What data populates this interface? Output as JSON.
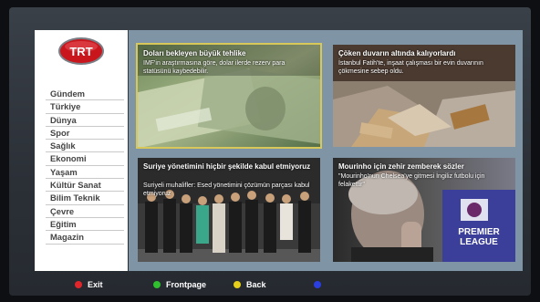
{
  "menu": {
    "items": [
      "Gündem",
      "Türkiye",
      "Dünya",
      "Spor",
      "Sağlık",
      "Ekonomi",
      "Yaşam",
      "Kültür Sanat",
      "Bilim Teknik",
      "Çevre",
      "Eğitim",
      "Magazin"
    ]
  },
  "logo": {
    "text": "TRT"
  },
  "tiles": [
    {
      "title": "Doları bekleyen büyük tehlike",
      "subtitle": "IMF'in araştırmasına göre, dolar ilerde rezerv para statüsünü kaybedebilir."
    },
    {
      "title": "Çöken duvarın altında kalıyorlardı",
      "subtitle": "İstanbul Fatih'te, inşaat çalışması bir evin duvarının çökmesine sebep oldu."
    },
    {
      "title": "Suriye yönetimini hiçbir şekilde kabul etmiyoruz",
      "subtitle": "Suriyeli muhalifler: Esed yönetimini çözümün parçası kabul etmiyoruz"
    },
    {
      "title": "Mourinho için zehir zemberek sözler",
      "subtitle": "\"Mourinho'nun Chelsea'ye gitmesi İngiliz futbolu için felakettir\"",
      "badge_line1": "PREMIER",
      "badge_line2": "LEAGUE"
    }
  ],
  "footer": {
    "exit_label": "Exit",
    "frontpage_label": "Frontpage",
    "back_label": "Back"
  },
  "colors": {
    "red": "#e0262b",
    "green": "#2fbf2f",
    "yellow": "#e6cf1a",
    "blue": "#2b3ee0",
    "highlight": "#d8c85a"
  }
}
